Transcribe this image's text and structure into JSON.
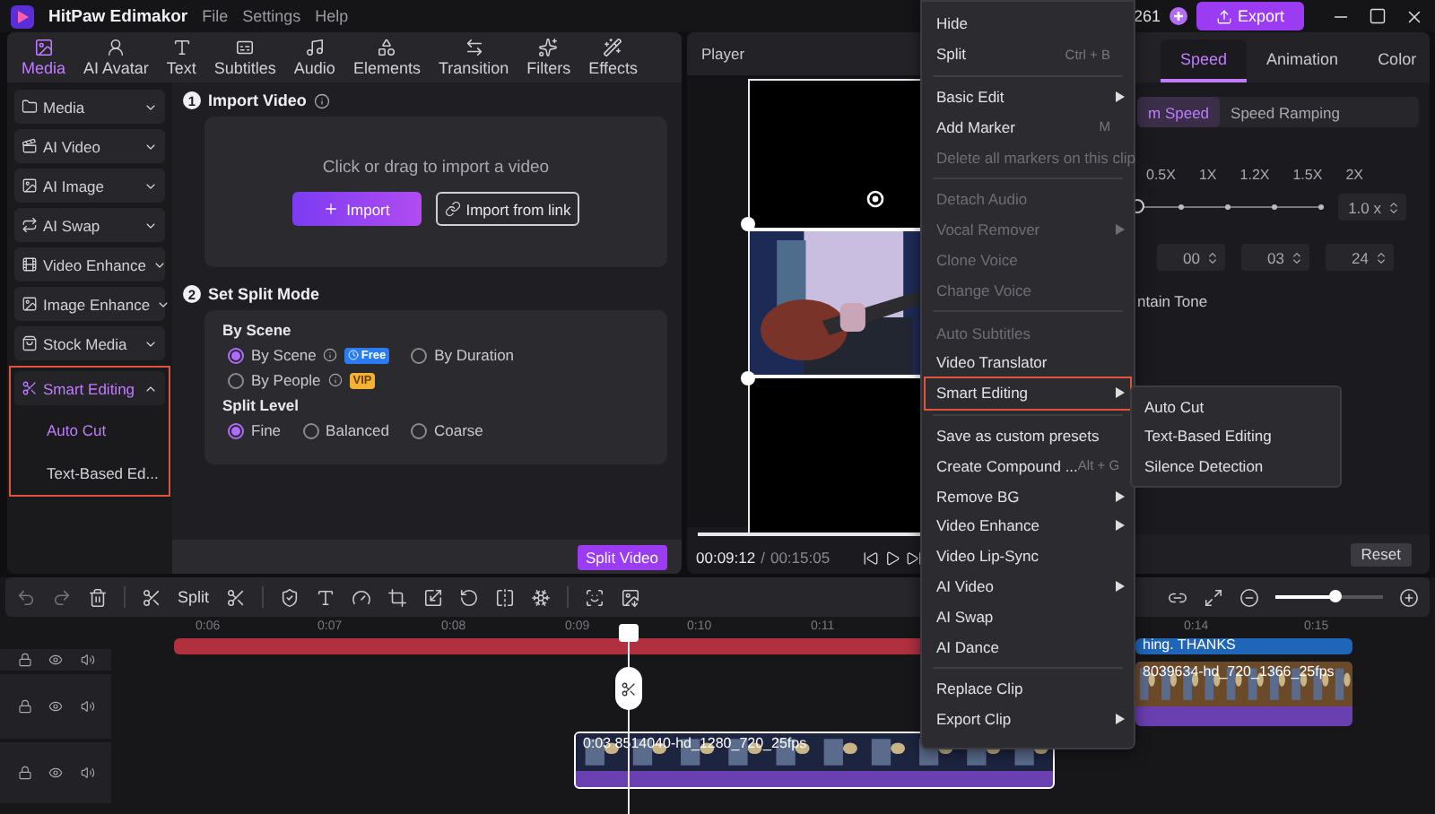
{
  "title_bar": {
    "app_name": "HitPaw Edimakor",
    "menus": [
      "File",
      "Settings",
      "Help"
    ],
    "credits": "261",
    "export_button": "Export"
  },
  "main_tabs": [
    {
      "label": "Media",
      "selected": true
    },
    {
      "label": "AI Avatar",
      "selected": false
    },
    {
      "label": "Text",
      "selected": false
    },
    {
      "label": "Subtitles",
      "selected": false
    },
    {
      "label": "Audio",
      "selected": false
    },
    {
      "label": "Elements",
      "selected": false
    },
    {
      "label": "Transition",
      "selected": false
    },
    {
      "label": "Filters",
      "selected": false
    },
    {
      "label": "Effects",
      "selected": false
    }
  ],
  "sidebar": [
    {
      "label": "Media",
      "expanded": false,
      "selected": false,
      "highlighted": false
    },
    {
      "label": "AI Video",
      "expanded": false,
      "selected": false,
      "highlighted": false
    },
    {
      "label": "AI Image",
      "expanded": false,
      "selected": false,
      "highlighted": false
    },
    {
      "label": "AI Swap",
      "expanded": false,
      "selected": false,
      "highlighted": false
    },
    {
      "label": "Video Enhance",
      "expanded": false,
      "selected": false,
      "highlighted": false
    },
    {
      "label": "Image Enhance",
      "expanded": false,
      "selected": false,
      "highlighted": false
    },
    {
      "label": "Stock Media",
      "expanded": false,
      "selected": false,
      "highlighted": false
    },
    {
      "label": "Smart Editing",
      "expanded": true,
      "selected": true,
      "highlighted": true,
      "children": [
        {
          "label": "Auto Cut",
          "selected": true
        },
        {
          "label": "Text-Based Ed...",
          "selected": false
        }
      ]
    }
  ],
  "import_section": {
    "step": "1",
    "title": "Import Video",
    "hint": "Click or drag to import a video",
    "import_button": "Import",
    "link_button": "Import from link"
  },
  "split_section": {
    "step": "2",
    "title": "Set Split Mode",
    "scene_heading": "By Scene",
    "scene_options": [
      {
        "label": "By Scene",
        "selected": true,
        "badge": "Free"
      },
      {
        "label": "By Duration",
        "selected": false
      },
      {
        "label": "By People",
        "selected": false,
        "badge": "VIP"
      }
    ],
    "level_heading": "Split Level",
    "level_options": [
      {
        "label": "Fine",
        "selected": true
      },
      {
        "label": "Balanced",
        "selected": false
      },
      {
        "label": "Coarse",
        "selected": false
      }
    ],
    "split_button": "Split Video"
  },
  "player": {
    "title": "Player",
    "current_time": "00:09:12",
    "separator": "/",
    "total_time": "00:15:05",
    "level": 1
  },
  "right_panel": {
    "tabs": [
      {
        "label": "Speed",
        "selected": true
      },
      {
        "label": "Animation",
        "selected": false
      },
      {
        "label": "Color",
        "selected": false
      }
    ],
    "modes": [
      {
        "label": "m Speed",
        "selected": true
      },
      {
        "label": "Speed Ramping",
        "selected": false
      }
    ],
    "speed_marks": [
      "0.5X",
      "1X",
      "1.2X",
      "1.5X",
      "2X"
    ],
    "level": 0,
    "speed_value": "1.0 x",
    "duration": [
      "00",
      "03",
      "24"
    ],
    "tone_label": "ntain Tone",
    "reset_button": "Reset"
  },
  "timeline": {
    "split_label": "Split",
    "zoom": {
      "level": 0.55
    },
    "ruler": [
      "0:06",
      "0:07",
      "0:08",
      "0:09",
      "0:10",
      "0:11",
      "0:14",
      "0:15"
    ],
    "clips": [
      {
        "kind": "effect"
      },
      {
        "kind": "subtitle",
        "label": "hing. THANKS"
      },
      {
        "kind": "overlay",
        "label": "8039634-hd_720_1366_25fps",
        "selected": false
      },
      {
        "kind": "main",
        "label": "0:03 8514040-hd_1280_720_25fps",
        "selected": true
      }
    ]
  },
  "context_menu": {
    "sections": [
      [
        {
          "label": "Hide",
          "disabled": false,
          "submenu": false,
          "highlighted": false
        },
        {
          "label": "Split",
          "shortcut": "Ctrl + B",
          "disabled": false,
          "submenu": false,
          "highlighted": false
        }
      ],
      [
        {
          "label": "Basic Edit",
          "disabled": false,
          "submenu": true,
          "highlighted": false
        },
        {
          "label": "Add Marker",
          "shortcut": "M",
          "disabled": false,
          "submenu": false,
          "highlighted": false
        },
        {
          "label": "Delete all markers on this clip",
          "disabled": true,
          "submenu": false,
          "highlighted": false
        }
      ],
      [
        {
          "label": "Detach Audio",
          "disabled": true,
          "submenu": false,
          "highlighted": false
        },
        {
          "label": "Vocal Remover",
          "disabled": true,
          "submenu": true,
          "highlighted": false
        },
        {
          "label": "Clone Voice",
          "disabled": true,
          "submenu": false,
          "highlighted": false
        },
        {
          "label": "Change Voice",
          "disabled": true,
          "submenu": false,
          "highlighted": false
        }
      ],
      [
        {
          "label": "Auto Subtitles",
          "disabled": true,
          "submenu": false,
          "highlighted": false
        },
        {
          "label": "Video Translator",
          "disabled": false,
          "submenu": false,
          "highlighted": false
        },
        {
          "label": "Smart Editing",
          "disabled": false,
          "submenu": true,
          "highlighted": true
        }
      ],
      [
        {
          "label": "Save as custom presets",
          "disabled": false,
          "submenu": false,
          "highlighted": false
        },
        {
          "label": "Create Compound ...",
          "shortcut": "Alt + G",
          "disabled": false,
          "submenu": false,
          "highlighted": false
        },
        {
          "label": "Remove BG",
          "disabled": false,
          "submenu": true,
          "highlighted": false
        },
        {
          "label": "Video Enhance",
          "disabled": false,
          "submenu": true,
          "highlighted": false
        },
        {
          "label": "Video Lip-Sync",
          "disabled": false,
          "submenu": false,
          "highlighted": false
        },
        {
          "label": "AI Video",
          "disabled": false,
          "submenu": true,
          "highlighted": false
        },
        {
          "label": "AI Swap",
          "disabled": false,
          "submenu": false,
          "highlighted": false
        },
        {
          "label": "AI Dance",
          "disabled": false,
          "submenu": false,
          "highlighted": false
        }
      ],
      [
        {
          "label": "Replace Clip",
          "disabled": false,
          "submenu": false,
          "highlighted": false
        },
        {
          "label": "Export Clip",
          "disabled": false,
          "submenu": true,
          "highlighted": false
        }
      ]
    ],
    "submenu": [
      "Auto Cut",
      "Text-Based Editing",
      "Silence Detection"
    ]
  }
}
